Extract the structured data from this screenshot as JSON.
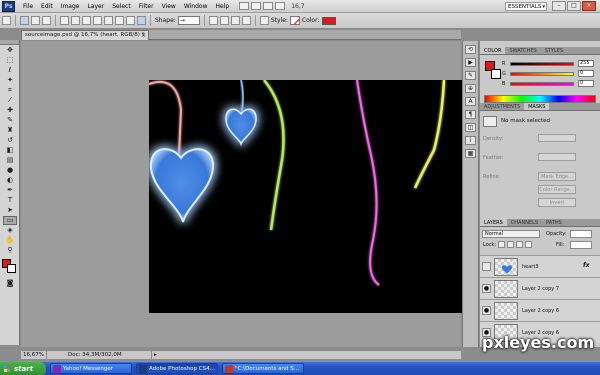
{
  "app": {
    "logo": "Ps",
    "menus": [
      "File",
      "Edit",
      "Image",
      "Layer",
      "Select",
      "Filter",
      "View",
      "Window",
      "Help"
    ],
    "zoom_menu": "16,7",
    "workspace": "ESSENTIALS",
    "window_controls": [
      "–",
      "□",
      "×"
    ]
  },
  "options_bar": {
    "shape_label": "Shape:",
    "style_label": "Style:",
    "color_label": "Color:",
    "color_hex": "#e0181a"
  },
  "document": {
    "tab_title": "sourceimage.psd @ 16,7% (heart, RGB/8) *",
    "close": "×"
  },
  "status": {
    "zoom": "16,67%",
    "doc_info": "Doc: 34,3M/302,0M",
    "arrow": "▸"
  },
  "color_panel": {
    "tabs": [
      "COLOR",
      "SWATCHES",
      "STYLES"
    ],
    "channels": [
      {
        "label": "R",
        "value": "255"
      },
      {
        "label": "G",
        "value": "0"
      },
      {
        "label": "B",
        "value": "0"
      }
    ],
    "fg_hex": "#e0181a"
  },
  "masks_panel": {
    "tabs": [
      "ADJUSTMENTS",
      "MASKS"
    ],
    "status": "No mask selected",
    "density_label": "Density:",
    "feather_label": "Feather:",
    "refine_label": "Refine:",
    "mask_edge": "Mask Edge...",
    "color_range": "Color Range...",
    "invert": "Invert"
  },
  "layers_panel": {
    "tabs": [
      "LAYERS",
      "CHANNELS",
      "PATHS"
    ],
    "blend_mode": "Normal",
    "opacity_label": "Opacity:",
    "lock_label": "Lock:",
    "fill_label": "Fill:",
    "fx_label": "fx",
    "layers": [
      {
        "name": "heart3",
        "fx": true
      },
      {
        "name": "Layer 2 copy 7",
        "fx": false
      },
      {
        "name": "Layer 2 copy 6",
        "fx": false
      },
      {
        "name": "Layer 2 copy 6",
        "fx": false
      }
    ]
  },
  "watermark": "pxleyes.com",
  "taskbar": {
    "start": "start",
    "items": [
      {
        "label": "Yahoo! Messenger",
        "icon_color": "#7a2bb5"
      },
      {
        "label": "Adobe Photoshop CS4...",
        "icon_color": "#1c3e78"
      },
      {
        "label": "\"C:\\Documents and S...",
        "icon_color": "#c0392b"
      }
    ]
  }
}
